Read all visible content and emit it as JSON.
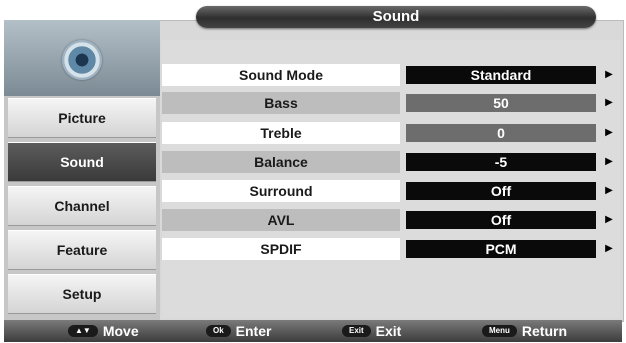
{
  "header": {
    "title": "Sound"
  },
  "sidebar": {
    "logo_icon": "speaker-icon",
    "items": [
      {
        "label": "Picture"
      },
      {
        "label": "Sound"
      },
      {
        "label": "Channel"
      },
      {
        "label": "Feature"
      },
      {
        "label": "Setup"
      }
    ],
    "active_index": 1
  },
  "settings": [
    {
      "label": "Sound Mode",
      "value": "Standard"
    },
    {
      "label": "Bass",
      "value": "50"
    },
    {
      "label": "Treble",
      "value": "0"
    },
    {
      "label": "Balance",
      "value": "-5"
    },
    {
      "label": "Surround",
      "value": "Off"
    },
    {
      "label": "AVL",
      "value": "Off"
    },
    {
      "label": "SPDIF",
      "value": "PCM"
    }
  ],
  "arrow_glyph": "▶",
  "footer": {
    "hints": [
      {
        "key": "▲▼",
        "label": "Move"
      },
      {
        "key": "Ok",
        "label": "Enter"
      },
      {
        "key": "Exit",
        "label": "Exit"
      },
      {
        "key": "Menu",
        "label": "Return"
      }
    ]
  }
}
